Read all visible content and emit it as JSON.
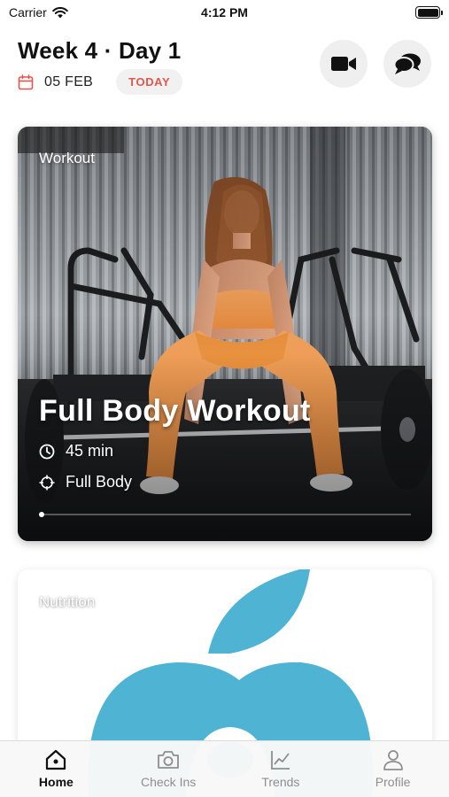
{
  "status_bar": {
    "carrier": "Carrier",
    "time": "4:12 PM"
  },
  "header": {
    "title": "Week 4 · Day 1",
    "date": "05 FEB",
    "today_badge": "TODAY",
    "icons": [
      "calendar-icon",
      "video-icon",
      "chat-icon"
    ]
  },
  "workout_card": {
    "label": "Workout",
    "title": "Full Body Workout",
    "duration": "45 min",
    "focus": "Full Body"
  },
  "nutrition_card": {
    "label": "Nutrition",
    "accent_color": "#4fb3d4"
  },
  "tab_bar": {
    "tabs": [
      {
        "label": "Home",
        "icon": "home-icon",
        "active": true
      },
      {
        "label": "Check Ins",
        "icon": "camera-icon",
        "active": false
      },
      {
        "label": "Trends",
        "icon": "chart-icon",
        "active": false
      },
      {
        "label": "Profile",
        "icon": "person-icon",
        "active": false
      }
    ]
  },
  "colors": {
    "today_text": "#e2574c",
    "calendar_icon": "#e2574c",
    "button_bg": "#efefef",
    "tab_inactive": "#8e8e8e"
  }
}
